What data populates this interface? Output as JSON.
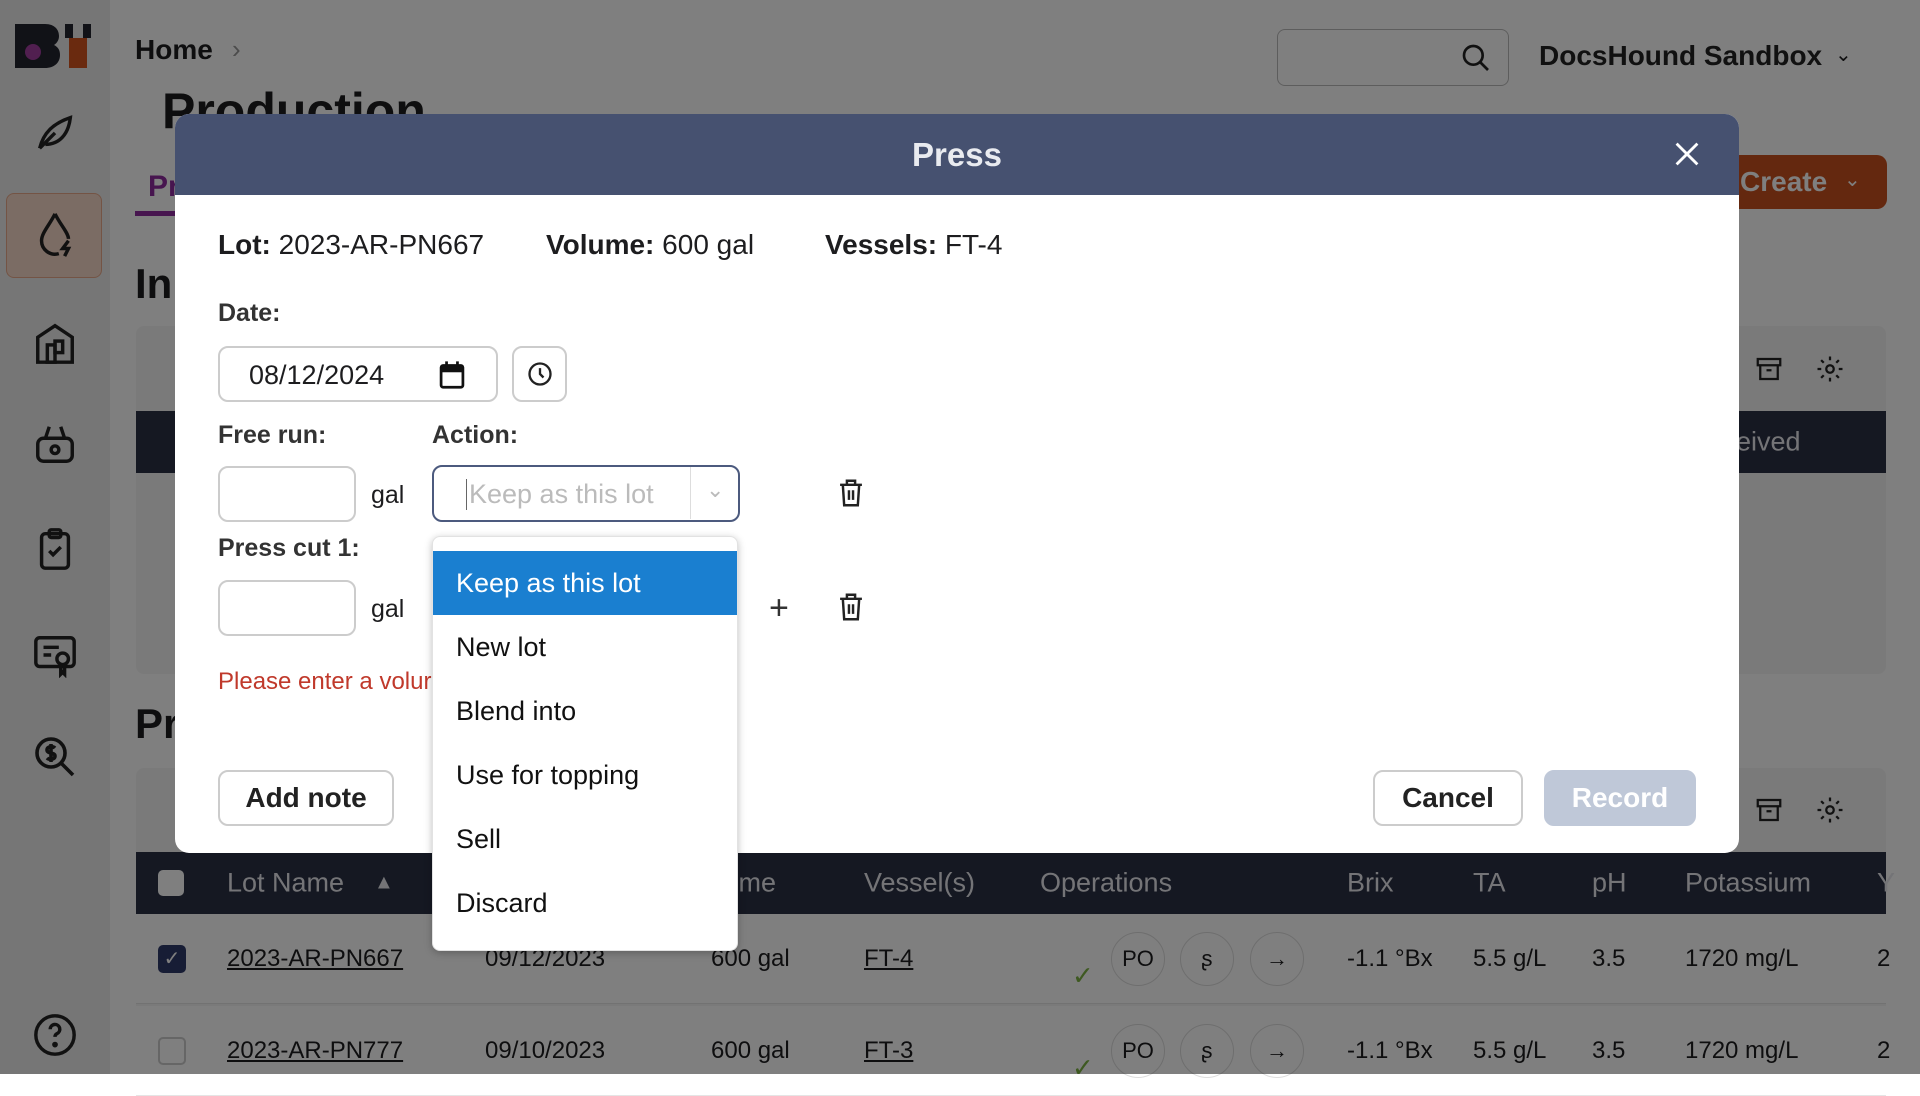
{
  "sidebar": {
    "items": [
      {
        "icon": "logo"
      },
      {
        "icon": "leaf-icon"
      },
      {
        "icon": "drop-bolt-icon",
        "active": true
      },
      {
        "icon": "building-icon"
      },
      {
        "icon": "basket-icon"
      },
      {
        "icon": "clipboard-check-icon"
      },
      {
        "icon": "certificate-icon"
      },
      {
        "icon": "dollar-search-icon"
      },
      {
        "icon": "help-icon"
      }
    ]
  },
  "header": {
    "breadcrumb": "Home",
    "page_title": "Production",
    "tab_partial": "Pr",
    "account": "DocsHound Sandbox",
    "create_label": "Create",
    "search_placeholder": ""
  },
  "background": {
    "section1_partial": "In",
    "section1_header_partial": "eived",
    "section2_partial": "Pr"
  },
  "table": {
    "columns": [
      "Lot Name",
      "Volume",
      "Vessel(s)",
      "Operations",
      "Brix",
      "TA",
      "pH",
      "Potassium",
      "Y"
    ],
    "sort": "Lot Name ascending",
    "rows": [
      {
        "checked": true,
        "lot": "2023-AR-PN667",
        "date": "09/12/2023",
        "volume": "600 gal",
        "vessel": "FT-4",
        "ops": [
          "PO",
          "ʂ",
          "→"
        ],
        "brix": "-1.1 °Bx",
        "ta": "5.5 g/L",
        "ph": "3.5",
        "potassium": "1720 mg/L",
        "y": "2"
      },
      {
        "checked": false,
        "lot": "2023-AR-PN777",
        "date": "09/10/2023",
        "volume": "600 gal",
        "vessel": "FT-3",
        "ops": [
          "PO",
          "ʂ",
          "→"
        ],
        "brix": "-1.1 °Bx",
        "ta": "5.5 g/L",
        "ph": "3.5",
        "potassium": "1720 mg/L",
        "y": "2"
      }
    ]
  },
  "modal": {
    "title": "Press",
    "lot_label": "Lot:",
    "lot": "2023-AR-PN667",
    "volume_label": "Volume:",
    "volume": "600 gal",
    "vessels_label": "Vessels:",
    "vessels": "FT-4",
    "date_label": "Date:",
    "date": "08/12/2024",
    "free_run_label": "Free run:",
    "free_run_value": "",
    "unit": "gal",
    "action_label": "Action:",
    "action_placeholder": "Keep as this lot",
    "press_cut_label": "Press cut 1:",
    "press_cut_value": "",
    "error": "Please enter a volur",
    "add_note": "Add note",
    "cancel": "Cancel",
    "record": "Record",
    "dropdown_options": [
      "Keep as this lot",
      "New lot",
      "Blend into",
      "Use for topping",
      "Sell",
      "Discard"
    ],
    "dropdown_selected": "Keep as this lot"
  },
  "colors": {
    "modal_header": "#465170",
    "accent_blue": "#1a7fd0",
    "create_orange": "#c8501e",
    "error_red": "#c0392b",
    "table_header": "#2a3044",
    "tab_purple": "#8e2a9e"
  }
}
